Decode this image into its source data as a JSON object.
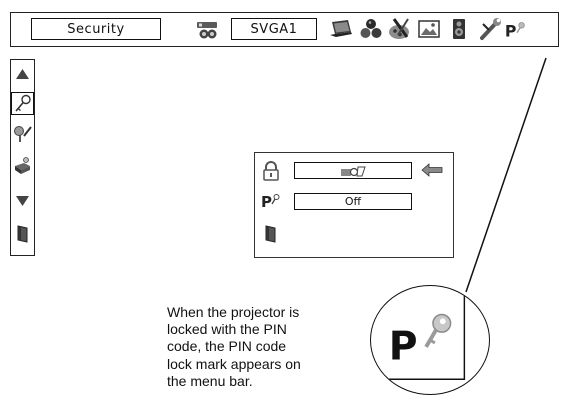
{
  "menubar": {
    "active_menu_label": "Security",
    "input_source_label": "SVGA1",
    "icons": [
      "projector-source-icon",
      "laptop-icon",
      "color-balls-icon",
      "palette-tools-icon",
      "screen-picture-icon",
      "speaker-icon",
      "wrench-icon",
      "pin-lock-mark-icon"
    ]
  },
  "left_menu": {
    "icons": [
      "up-arrow-icon",
      "key-icon",
      "key-check-icon",
      "projector-key-icon",
      "down-arrow-icon",
      "exit-door-icon"
    ],
    "selected": "key-icon"
  },
  "security_panel": {
    "logo_lock_value_icon": "logo-projector-icon",
    "pin_code_lock_value": "Off",
    "pointer": "left-arrow-icon"
  },
  "caption": {
    "text": "When the projector is\nlocked with the PIN\ncode, the PIN code\nlock mark appears on\nthe menu bar."
  },
  "colors": {
    "border": "#222222",
    "icon_dark": "#2a2a2a",
    "icon_mid": "#7a7a7a",
    "icon_light": "#bdbdbd"
  }
}
